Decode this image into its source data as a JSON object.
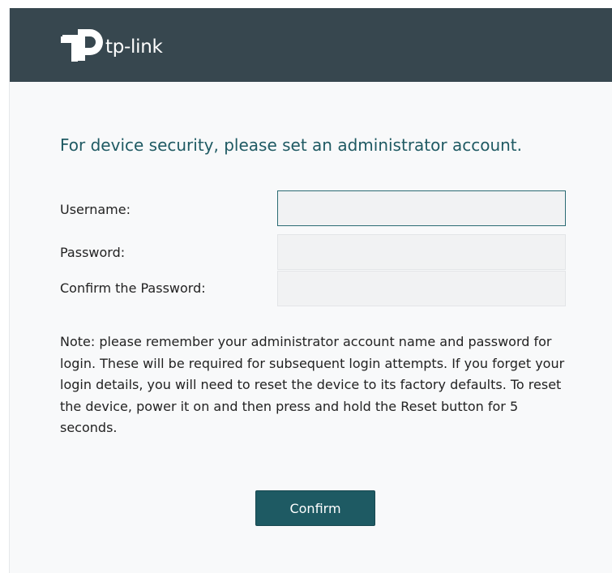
{
  "brand": {
    "logo_text": "tp-link",
    "header_color": "#37474f"
  },
  "form": {
    "heading": "For device security, please set an administrator account.",
    "username_label": "Username:",
    "username_value": "",
    "password_label": "Password:",
    "password_value": "",
    "confirm_password_label": "Confirm the Password:",
    "confirm_password_value": "",
    "note": "Note: please remember your administrator account name and password for login. These will be required for subsequent login attempts. If you forget your login details, you will need to reset the device to its factory defaults. To reset the device, power it on and then press and hold the Reset button for 5 seconds.",
    "confirm_label": "Confirm",
    "accent_color": "#1e5a63"
  }
}
